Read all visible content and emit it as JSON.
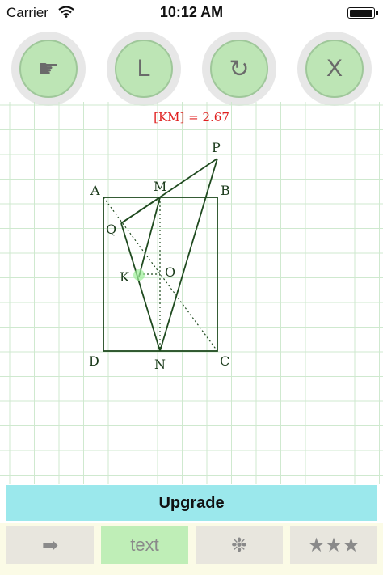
{
  "status_bar": {
    "carrier": "Carrier",
    "time": "10:12 AM",
    "battery_level": 1.0
  },
  "toolbar": {
    "buttons": [
      {
        "label": "☛",
        "icon": "pointing-hand-icon"
      },
      {
        "label": "L",
        "icon": "line-letter-icon"
      },
      {
        "label": "↻",
        "icon": "redo-circular-arrow-icon"
      },
      {
        "label": "X",
        "icon": "clear-letter-icon"
      }
    ]
  },
  "drawing": {
    "readout": "[KM] = 2.67",
    "points": {
      "A": "A",
      "B": "B",
      "C": "C",
      "D": "D",
      "M": "M",
      "N": "N",
      "O": "O",
      "K": "K",
      "P": "P",
      "Q": "Q"
    },
    "colors": {
      "grid": "#cfe9cf",
      "figure": "#1f4a1f",
      "readout": "#e02020",
      "highlight": "#9ef09a"
    }
  },
  "upgrade": {
    "label": "Upgrade"
  },
  "bottom_bar": {
    "tabs": [
      {
        "label": "➡",
        "icon": "arrow-right-icon"
      },
      {
        "label": "text",
        "icon": ""
      },
      {
        "label": "❉",
        "icon": "asterisk-flower-icon"
      },
      {
        "label": "★★★",
        "icon": "three-stars-icon"
      }
    ],
    "active_tab": 1
  }
}
